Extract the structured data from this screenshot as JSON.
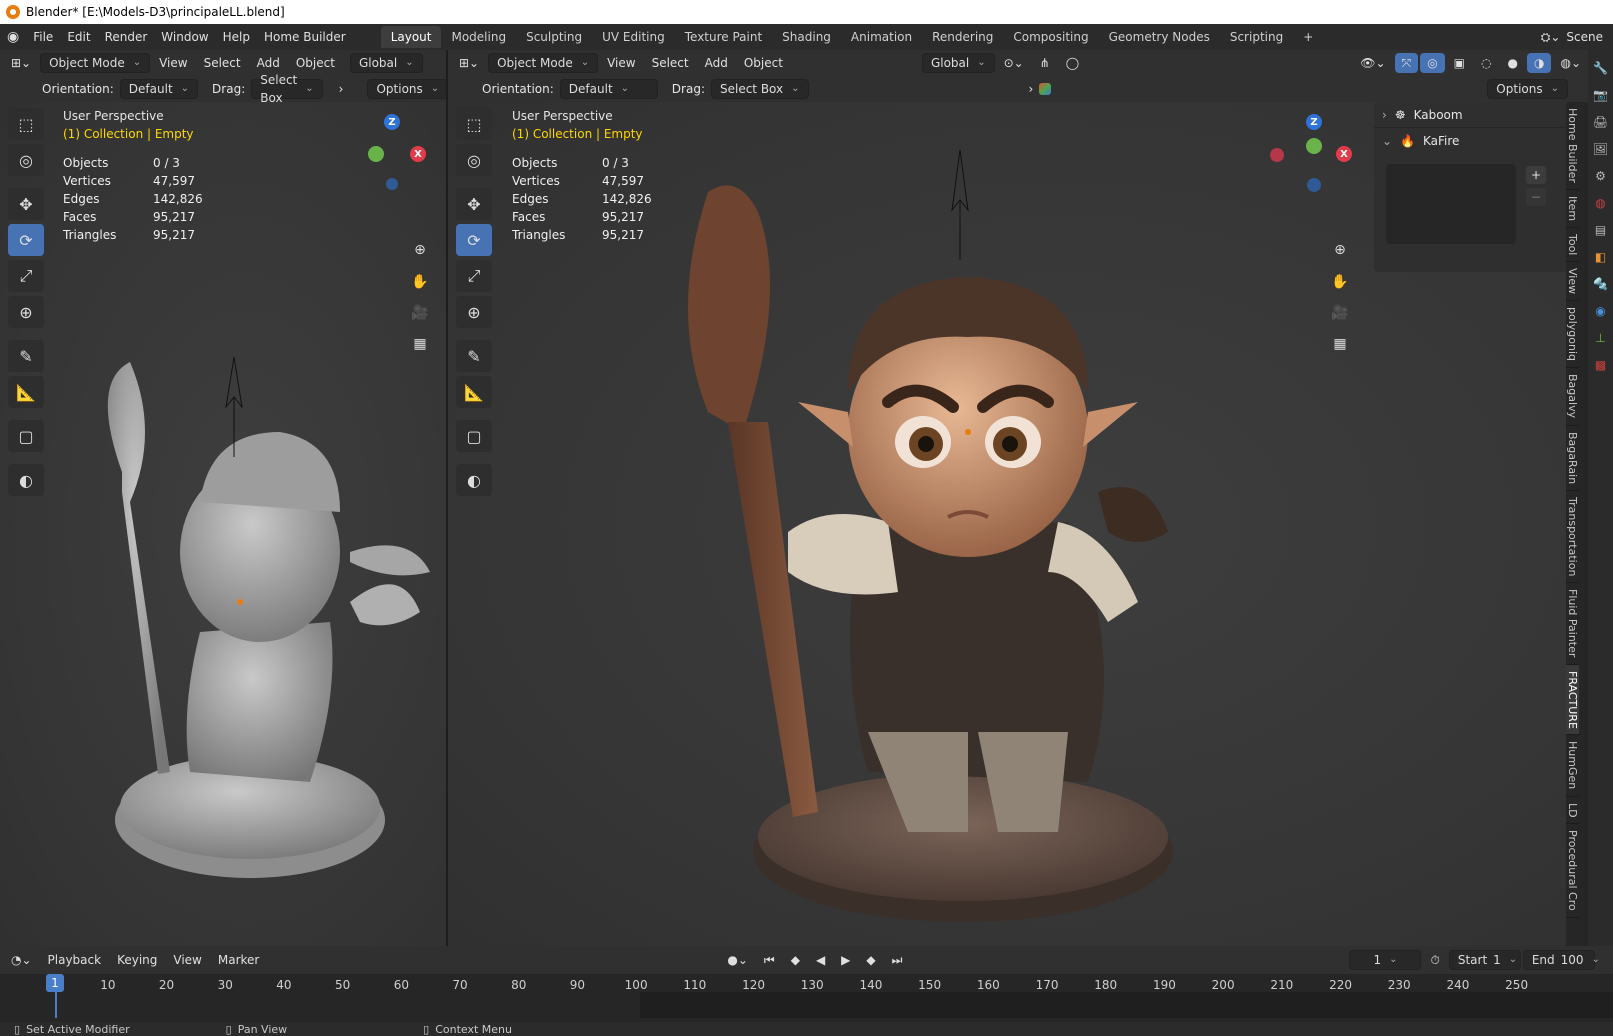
{
  "window": {
    "title": "Blender* [E:\\Models-D3\\principaleLL.blend]"
  },
  "menu": [
    "File",
    "Edit",
    "Render",
    "Window",
    "Help",
    "Home Builder"
  ],
  "workspaces": [
    "Layout",
    "Modeling",
    "Sculpting",
    "UV Editing",
    "Texture Paint",
    "Shading",
    "Animation",
    "Rendering",
    "Compositing",
    "Geometry Nodes",
    "Scripting"
  ],
  "active_workspace": "Layout",
  "scene": {
    "label": "Scene"
  },
  "left_view": {
    "mode": "Object Mode",
    "menus": [
      "View",
      "Select",
      "Add",
      "Object"
    ],
    "orientation_label": "Orientation:",
    "orientation": "Default",
    "drag_label": "Drag:",
    "drag": "Select Box",
    "transform": "Global",
    "options": "Options",
    "persp": "User Perspective",
    "collection": "(1) Collection | Empty",
    "stats": [
      [
        "Objects",
        "0 / 3"
      ],
      [
        "Vertices",
        "47,597"
      ],
      [
        "Edges",
        "142,826"
      ],
      [
        "Faces",
        "95,217"
      ],
      [
        "Triangles",
        "95,217"
      ]
    ]
  },
  "right_view": {
    "mode": "Object Mode",
    "menus": [
      "View",
      "Select",
      "Add",
      "Object"
    ],
    "orientation_label": "Orientation:",
    "orientation": "Default",
    "drag_label": "Drag:",
    "drag": "Select Box",
    "transform": "Global",
    "options": "Options",
    "persp": "User Perspective",
    "collection": "(1) Collection | Empty",
    "stats": [
      [
        "Objects",
        "0 / 3"
      ],
      [
        "Vertices",
        "47,597"
      ],
      [
        "Edges",
        "142,826"
      ],
      [
        "Faces",
        "95,217"
      ],
      [
        "Triangles",
        "95,217"
      ]
    ],
    "npanel": {
      "kaboom": "Kaboom",
      "kafire": "KaFire"
    }
  },
  "sidebar_tabs": [
    "Home Builder",
    "Item",
    "Tool",
    "View",
    "polygoniq",
    "Bagalvy",
    "BagaRain",
    "Transportation",
    "Fluid Painter",
    "FRACTURE",
    "HumGen",
    "LD",
    "Procedural Cro"
  ],
  "sidebar_active": "FRACTURE",
  "gizmo": {
    "x": "X",
    "y": "Y",
    "z": "Z"
  },
  "timeline": {
    "menus": [
      "Playback",
      "Keying",
      "View",
      "Marker"
    ],
    "current_frame": "1",
    "start_label": "Start",
    "start": "1",
    "end_label": "End",
    "end": "100",
    "ticks": [
      "1",
      "10",
      "20",
      "30",
      "40",
      "50",
      "60",
      "70",
      "80",
      "90",
      "100",
      "110",
      "120",
      "130",
      "140",
      "150",
      "160",
      "170",
      "180",
      "190",
      "200",
      "210",
      "220",
      "230",
      "240",
      "250"
    ]
  },
  "status": {
    "left": "Set Active Modifier",
    "mid": "Pan View",
    "right": "Context Menu"
  },
  "colors": {
    "accent": "#4772b3",
    "selected_text": "#ffd700",
    "frame_marker": "#4a7ec9"
  }
}
